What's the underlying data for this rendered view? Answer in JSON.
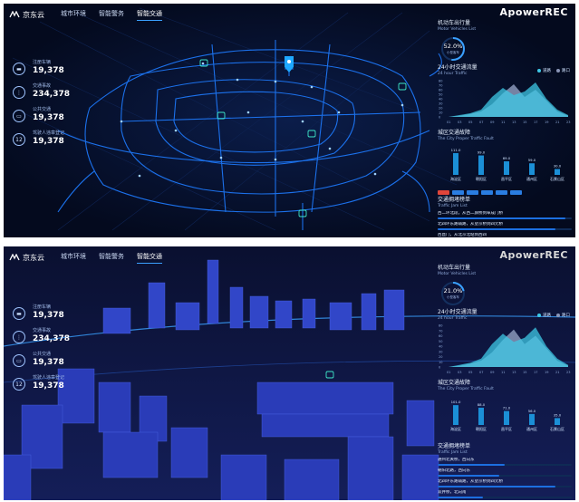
{
  "app": {
    "logo_text": "京东云",
    "watermark": "ApowerREC"
  },
  "nav": {
    "items": [
      "城市环境",
      "智能警务",
      "智能交通"
    ],
    "active_index": 2
  },
  "screens": [
    {
      "stats": [
        {
          "icon": "car-icon",
          "label": "注册车辆",
          "value": "19,378"
        },
        {
          "icon": "traffic-light-icon",
          "label": "交通事故",
          "value": "234,378"
        },
        {
          "icon": "bus-icon",
          "label": "公共交通",
          "value": "19,378"
        },
        {
          "icon": "number-12-icon",
          "label": "驾驶人违章登记",
          "value": "19,378"
        }
      ],
      "panel": {
        "motor": {
          "title": "机动车出行量",
          "subtitle": "Motor Vehicles List",
          "percent": "52.0%",
          "caption": "小型客车",
          "fraction": 0.52
        },
        "traffic24": {
          "title": "24小时交通流量",
          "subtitle": "24 hour Traffic",
          "legend": [
            "道路",
            "路口"
          ],
          "y_ticks": [
            "80",
            "70",
            "60",
            "50",
            "40",
            "30",
            "20",
            "10",
            "0"
          ],
          "x_ticks": [
            "01",
            "03",
            "05",
            "07",
            "09",
            "11",
            "13",
            "15",
            "17",
            "19",
            "21",
            "23"
          ]
        },
        "fault": {
          "title": "城区交通故障",
          "subtitle": "The City Proper Traffic Fault",
          "categories": [
            "海淀区",
            "朝阳区",
            "昌平区",
            "通州区",
            "石景山区"
          ],
          "value_labels": [
            "111.0",
            "99.0",
            "69.0",
            "59.0",
            "30.0"
          ],
          "values": [
            111,
            99,
            69,
            59,
            30
          ]
        },
        "jam": {
          "title": "交通拥堵榜单",
          "subtitle": "Traffic Jam List",
          "items": [
            "西二环北段，从西二旗桥到阜成门桥",
            "北四环东路辅路，从望京桥到四元桥",
            "西直门，从北京北站到西四",
            "朝阳北路，从东坝到望京",
            "学院路"
          ],
          "fractions": [
            0.95,
            0.88,
            0.72,
            0.58,
            0.45
          ]
        }
      }
    },
    {
      "stats": [
        {
          "icon": "car-icon",
          "label": "注册车辆",
          "value": "19,378"
        },
        {
          "icon": "traffic-light-icon",
          "label": "交通事故",
          "value": "234,378"
        },
        {
          "icon": "bus-icon",
          "label": "公共交通",
          "value": "19,378"
        },
        {
          "icon": "number-12-icon",
          "label": "驾驶人违章登记",
          "value": "19,378"
        }
      ],
      "panel": {
        "motor": {
          "title": "机动车出行量",
          "subtitle": "Motor Vehicles List",
          "percent": "21.0%",
          "caption": "小型客车",
          "fraction": 0.21
        },
        "traffic24": {
          "title": "24小时交通流量",
          "subtitle": "24 hour Traffic",
          "legend": [
            "道路",
            "路口"
          ],
          "y_ticks": [
            "80",
            "70",
            "60",
            "50",
            "40",
            "30",
            "20",
            "10",
            "0"
          ],
          "x_ticks": [
            "01",
            "03",
            "05",
            "07",
            "09",
            "11",
            "13",
            "15",
            "17",
            "19",
            "21",
            "23"
          ]
        },
        "fault": {
          "title": "城区交通故障",
          "subtitle": "The City Proper Traffic Fault",
          "categories": [
            "海淀区",
            "朝阳区",
            "昌平区",
            "通州区",
            "石景山区"
          ],
          "value_labels": [
            "101.0",
            "88.0",
            "71.0",
            "56.0",
            "35.0"
          ],
          "values": [
            101,
            88,
            71,
            56,
            35
          ]
        },
        "jam": {
          "title": "交通拥堵榜单",
          "subtitle": "Traffic Jam List",
          "items": [
            "通州北关桥，西向东",
            "朝阳北路，西向东",
            "北四环东路辅路，从望京桥到四元桥",
            "双井桥，北向南",
            "西直门，从北京北站到西四"
          ],
          "fractions": [
            0.5,
            0.46,
            0.88,
            0.34,
            0.9
          ]
        }
      }
    }
  ],
  "colors": {
    "accent": "#3aa0ff",
    "road": "#1e7bff",
    "bar": "#1b8fd6",
    "area_road": "#3ec8e6",
    "area_junction": "#8a96b8"
  }
}
